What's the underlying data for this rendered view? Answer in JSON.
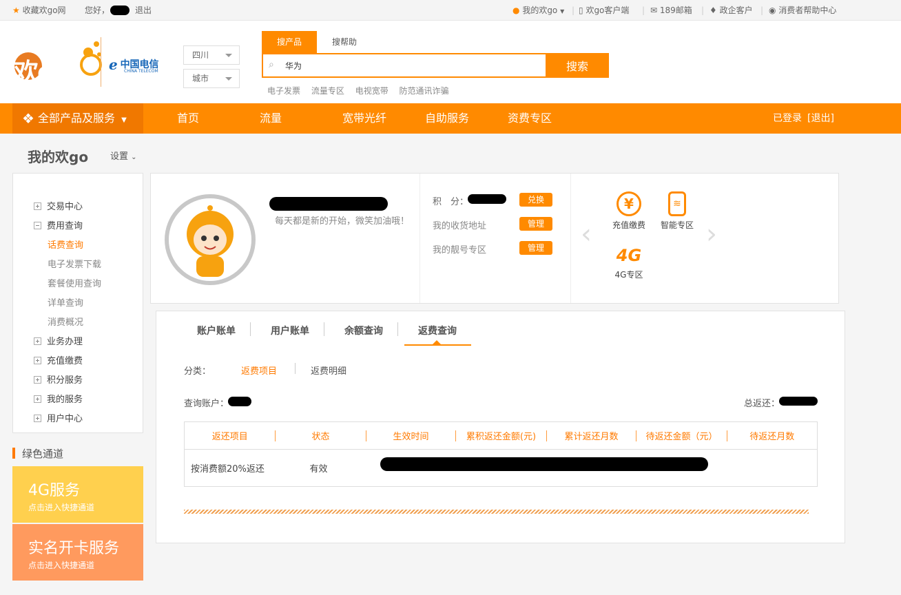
{
  "topbar": {
    "favorite": "收藏欢go网",
    "greeting": "您好，",
    "logout": "退出",
    "my_huango": "我的欢go",
    "client": "欢go客户端",
    "mail": "189邮箱",
    "enterprise": "政企客户",
    "help": "消费者帮助中心"
  },
  "header": {
    "logo_text": "欢go",
    "telecom_cn": "中国电信",
    "telecom_en": "CHINA TELECOM",
    "province": "四川",
    "city": "城市",
    "search_tabs": [
      "搜产品",
      "搜帮助"
    ],
    "search_value": "华为",
    "search_button": "搜索",
    "hot_links": [
      "电子发票",
      "流量专区",
      "电视宽带",
      "防范通讯诈骗"
    ]
  },
  "nav": {
    "all_products": "全部产品及服务",
    "items": [
      "首页",
      "流量",
      "宽带光纤",
      "自助服务",
      "资费专区"
    ],
    "logged_in": "已登录",
    "logout": "[退出]"
  },
  "page": {
    "title": "我的欢go",
    "settings": "设置"
  },
  "sidebar": {
    "groups": [
      {
        "label": "交易中心",
        "expanded": false
      },
      {
        "label": "费用查询",
        "expanded": true
      },
      {
        "label": "业务办理",
        "expanded": false
      },
      {
        "label": "充值缴费",
        "expanded": false
      },
      {
        "label": "积分服务",
        "expanded": false
      },
      {
        "label": "我的服务",
        "expanded": false
      },
      {
        "label": "用户中心",
        "expanded": false
      }
    ],
    "sub_items": [
      "话费查询",
      "电子发票下载",
      "套餐使用查询",
      "详单查询",
      "消费概况"
    ],
    "active_sub": "话费查询"
  },
  "green_channel": {
    "title": "绿色通道",
    "promo1_title": "4G服务",
    "promo1_sub": "点击进入快捷通道",
    "promo2_title": "实名开卡服务",
    "promo2_sub": "点击进入快捷通道"
  },
  "profile": {
    "motto": "每天都是新的开始，微笑加油哦！",
    "points_label": "积　分：",
    "points_button": "兑换",
    "address_label": "我的收货地址",
    "address_button": "管理",
    "number_label": "我的靓号专区",
    "number_button": "管理",
    "quick": [
      {
        "label": "充值缴费",
        "icon": "yuan-icon"
      },
      {
        "label": "智能专区",
        "icon": "smart-device-icon"
      },
      {
        "label": "4G专区",
        "icon": "4g-icon",
        "glyph": "4G"
      }
    ]
  },
  "content": {
    "tabs": [
      "账户账单",
      "用户账单",
      "余额查询",
      "返费查询"
    ],
    "active_tab": "返费查询",
    "category_label": "分类：",
    "categories": [
      "返费项目",
      "返费明细"
    ],
    "query_account_label": "查询账户：",
    "total_label": "总返还：",
    "table": {
      "headers": [
        "返还项目",
        "状态",
        "生效时间",
        "累积返还金额(元)",
        "累计返还月数",
        "待返还金额（元）",
        "待返还月数"
      ],
      "rows": [
        [
          "按消费额20%返还",
          "有效",
          "",
          "",
          "",
          "",
          ""
        ]
      ]
    }
  },
  "colors": {
    "brand_orange": "#ff8a00",
    "promo_yellow": "#ffd04e",
    "promo_salmon": "#ff9a5e"
  }
}
